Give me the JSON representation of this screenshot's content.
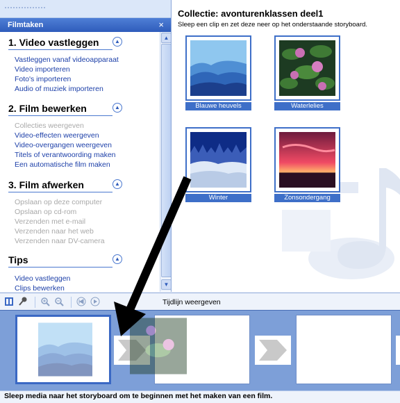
{
  "tasks_panel": {
    "header_title": "Filmtaken",
    "close_glyph": "×",
    "sections": [
      {
        "title": "1. Video vastleggen",
        "collapse_icon": "chevron-up-icon",
        "items": [
          {
            "label": "Vastleggen vanaf videoapparaat",
            "enabled": true
          },
          {
            "label": "Video importeren",
            "enabled": true
          },
          {
            "label": "Foto's importeren",
            "enabled": true
          },
          {
            "label": "Audio of muziek importeren",
            "enabled": true
          }
        ]
      },
      {
        "title": "2. Film bewerken",
        "collapse_icon": "chevron-up-icon",
        "items": [
          {
            "label": "Collecties weergeven",
            "enabled": false
          },
          {
            "label": "Video-effecten weergeven",
            "enabled": true
          },
          {
            "label": "Video-overgangen weergeven",
            "enabled": true
          },
          {
            "label": "Titels of verantwoording maken",
            "enabled": true
          },
          {
            "label": "Een automatische film maken",
            "enabled": true
          }
        ]
      },
      {
        "title": "3. Film afwerken",
        "collapse_icon": "chevron-up-icon",
        "items": [
          {
            "label": "Opslaan op deze computer",
            "enabled": false
          },
          {
            "label": "Opslaan op cd-rom",
            "enabled": false
          },
          {
            "label": "Verzenden met e-mail",
            "enabled": false
          },
          {
            "label": "Verzenden naar het web",
            "enabled": false
          },
          {
            "label": "Verzenden naar DV-camera",
            "enabled": false
          }
        ]
      },
      {
        "title": "Tips",
        "collapse_icon": "chevron-up-icon",
        "items": [
          {
            "label": "Video vastleggen",
            "enabled": true
          },
          {
            "label": "Clips bewerken",
            "enabled": true
          }
        ]
      }
    ]
  },
  "collection": {
    "title": "Collectie: avonturenklassen deel1",
    "instruction": "Sleep een clip en zet deze neer op het onderstaande storyboard.",
    "clips": [
      {
        "name": "Blauwe heuvels",
        "colors": {
          "sky": "#8fc7ef",
          "far": "#4f8fd4",
          "mid": "#2f66b8",
          "near": "#1c3f8c"
        }
      },
      {
        "name": "Waterlelies",
        "colors": {
          "water": "#1d3b22",
          "leaf": "#3f7a35",
          "flower": "#c96fb3"
        }
      },
      {
        "name": "Winter",
        "colors": {
          "sky": "#0e2c86",
          "snow": "#dfe9f7",
          "trees": "#3b5db8"
        }
      },
      {
        "name": "Zonsondergang",
        "colors": {
          "top": "#6e1b3d",
          "glow": "#f04a64",
          "horizon": "#ffb36b",
          "ground": "#2a0f22"
        }
      }
    ]
  },
  "storyboard_toolbar": {
    "icons": [
      "storyboard-icon",
      "narrate-icon",
      "zoom-in-icon",
      "zoom-out-icon",
      "rewind-icon",
      "play-icon"
    ],
    "timeline_toggle_label": "Tijdlijn weergeven"
  },
  "storyboard": {
    "drop_hint": "Sleep media naar het storyboard om te beginnen met het maken van een film."
  },
  "colors": {
    "accent": "#3e6fc8",
    "storyboard_bg": "#7d9fd8",
    "link": "#1c3fa8",
    "disabled": "#a9a9a9"
  }
}
